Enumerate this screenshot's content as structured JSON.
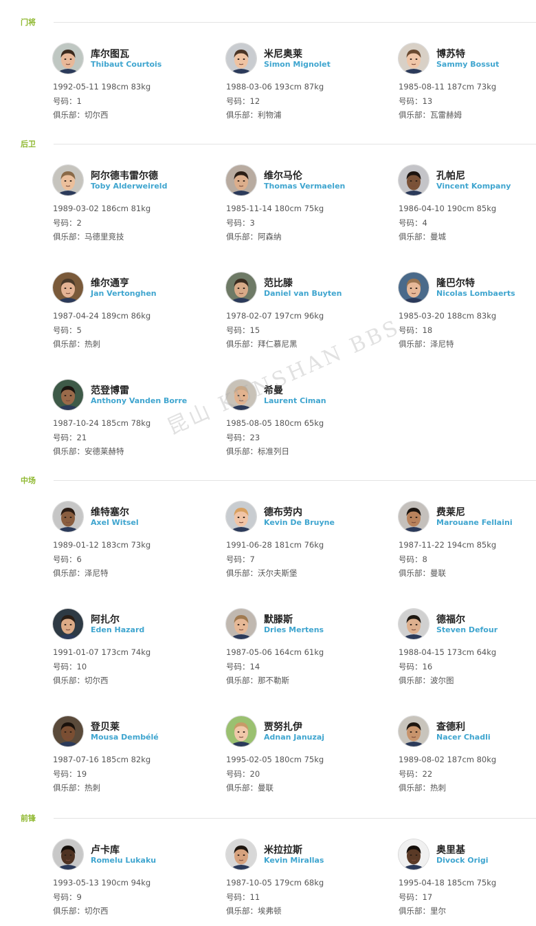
{
  "sections": [
    {
      "title": "门将",
      "players": [
        {
          "cn": "库尔图瓦",
          "en": "Thibaut Courtois",
          "stats": "1992-05-11  198cm  83kg",
          "number": "号码：1",
          "club": "俱乐部：切尔西",
          "skin": "#e8b899",
          "hair": "#3b2a1e",
          "bg": "#bfc7c2"
        },
        {
          "cn": "米尼奥莱",
          "en": "Simon Mignolet",
          "stats": "1988-03-06  193cm  87kg",
          "number": "号码：12",
          "club": "俱乐部：利物浦",
          "skin": "#eec3a3",
          "hair": "#4a3526",
          "bg": "#c9ccd0"
        },
        {
          "cn": "博苏特",
          "en": "Sammy Bossut",
          "stats": "1985-08-11  187cm  73kg",
          "number": "号码：13",
          "club": "俱乐部：瓦雷赫姆",
          "skin": "#f0c6a8",
          "hair": "#6a4a30",
          "bg": "#d8d0c6"
        }
      ]
    },
    {
      "title": "后卫",
      "players": [
        {
          "cn": "阿尔德韦雷尔德",
          "en": "Toby Alderweireld",
          "stats": "1989-03-02  186cm  81kg",
          "number": "号码：2",
          "club": "俱乐部：马德里竞技",
          "skin": "#ebbf9c",
          "hair": "#8a6a48",
          "bg": "#c6c4be"
        },
        {
          "cn": "维尔马伦",
          "en": "Thomas Vermaelen",
          "stats": "1985-11-14  180cm  75kg",
          "number": "号码：3",
          "club": "俱乐部：阿森纳",
          "skin": "#dcae8c",
          "hair": "#2a1e16",
          "bg": "#b8aba0"
        },
        {
          "cn": "孔帕尼",
          "en": "Vincent Kompany",
          "stats": "1986-04-10  190cm  85kg",
          "number": "号码：4",
          "club": "俱乐部：曼城",
          "skin": "#7a5238",
          "hair": "#1c1410",
          "bg": "#c4c4c8"
        },
        {
          "cn": "维尔通亨",
          "en": "Jan Vertonghen",
          "stats": "1987-04-24  189cm  86kg",
          "number": "号码：5",
          "club": "俱乐部：热刺",
          "skin": "#e4b394",
          "hair": "#4a3a2a",
          "bg": "#7a5a3a"
        },
        {
          "cn": "范比滕",
          "en": "Daniel van Buyten",
          "stats": "1978-02-07  197cm  96kg",
          "number": "号码：15",
          "club": "俱乐部：拜仁慕尼黑",
          "skin": "#d8aa88",
          "hair": "#3a2c20",
          "bg": "#6e7a66"
        },
        {
          "cn": "隆巴尔特",
          "en": "Nicolas Lombaerts",
          "stats": "1985-03-20  188cm  83kg",
          "number": "号码：18",
          "club": "俱乐部：泽尼特",
          "skin": "#e6b898",
          "hair": "#9a7450",
          "bg": "#4a6a8a"
        },
        {
          "cn": "范登博雷",
          "en": "Anthony Vanden Borre",
          "stats": "1987-10-24  185cm  78kg",
          "number": "号码：21",
          "club": "俱乐部：安德莱赫特",
          "skin": "#9a6a4a",
          "hair": "#1a1410",
          "bg": "#3e5a48"
        },
        {
          "cn": "希曼",
          "en": "Laurent Ciman",
          "stats": "1985-08-05  180cm  65kg",
          "number": "号码：23",
          "club": "俱乐部：标准列日",
          "skin": "#e2b28e",
          "hair": "#c8a888",
          "bg": "#c8c2b8"
        }
      ]
    },
    {
      "title": "中场",
      "players": [
        {
          "cn": "维特塞尔",
          "en": "Axel Witsel",
          "stats": "1989-01-12  183cm  73kg",
          "number": "号码：6",
          "club": "俱乐部：泽尼特",
          "skin": "#8a5e40",
          "hair": "#2a1c14",
          "bg": "#c6c6c6"
        },
        {
          "cn": "德布劳内",
          "en": "Kevin De Bruyne",
          "stats": "1991-06-28  181cm  76kg",
          "number": "号码：7",
          "club": "俱乐部：沃尔夫斯堡",
          "skin": "#f0c4a6",
          "hair": "#d8a060",
          "bg": "#c8ccd0"
        },
        {
          "cn": "费莱尼",
          "en": "Marouane Fellaini",
          "stats": "1987-11-22  194cm  85kg",
          "number": "号码：8",
          "club": "俱乐部：曼联",
          "skin": "#b8825c",
          "hair": "#1a1410",
          "bg": "#c4c0bc"
        },
        {
          "cn": "阿扎尔",
          "en": "Eden Hazard",
          "stats": "1991-01-07  173cm  74kg",
          "number": "号码：10",
          "club": "俱乐部：切尔西",
          "skin": "#dcaa86",
          "hair": "#2a1e16",
          "bg": "#2e3a44"
        },
        {
          "cn": "默滕斯",
          "en": "Dries Mertens",
          "stats": "1987-05-06  164cm  61kg",
          "number": "号码：14",
          "club": "俱乐部：那不勒斯",
          "skin": "#e6b896",
          "hair": "#a07a50",
          "bg": "#c0b8b0"
        },
        {
          "cn": "德福尔",
          "en": "Steven Defour",
          "stats": "1988-04-15  173cm  64kg",
          "number": "号码：16",
          "club": "俱乐部：波尔图",
          "skin": "#ddb08e",
          "hair": "#1e1812",
          "bg": "#d0d0d0"
        },
        {
          "cn": "登贝莱",
          "en": "Mousa Dembélé",
          "stats": "1987-07-16  185cm  82kg",
          "number": "号码：19",
          "club": "俱乐部：热刺",
          "skin": "#7a4e32",
          "hair": "#1a120c",
          "bg": "#5a4a3a"
        },
        {
          "cn": "贾努扎伊",
          "en": "Adnan Januzaj",
          "stats": "1995-02-05  180cm  75kg",
          "number": "号码：20",
          "club": "俱乐部：曼联",
          "skin": "#f0c8aa",
          "hair": "#c89a68",
          "bg": "#9ac070"
        },
        {
          "cn": "查德利",
          "en": "Nacer Chadli",
          "stats": "1989-08-02  187cm  80kg",
          "number": "号码：22",
          "club": "俱乐部：热刺",
          "skin": "#c8946c",
          "hair": "#1e1610",
          "bg": "#c8c4bc"
        }
      ]
    },
    {
      "title": "前锋",
      "players": [
        {
          "cn": "卢卡库",
          "en": "Romelu Lukaku",
          "stats": "1993-05-13  190cm  94kg",
          "number": "号码：9",
          "club": "俱乐部：切尔西",
          "skin": "#4e3222",
          "hair": "#140e0a",
          "bg": "#c8c8c8"
        },
        {
          "cn": "米拉拉斯",
          "en": "Kevin Mirallas",
          "stats": "1987-10-05  179cm  68kg",
          "number": "号码：11",
          "club": "俱乐部：埃弗顿",
          "skin": "#d6a27e",
          "hair": "#1e1610",
          "bg": "#d8d8d8"
        },
        {
          "cn": "奥里基",
          "en": "Divock Origi",
          "stats": "1995-04-18  185cm  75kg",
          "number": "号码：17",
          "club": "俱乐部：里尔",
          "skin": "#5a3a26",
          "hair": "#140e0a",
          "bg": "#f0f0f0"
        }
      ]
    }
  ],
  "watermark": "昆山 KUNSHAN BBS"
}
